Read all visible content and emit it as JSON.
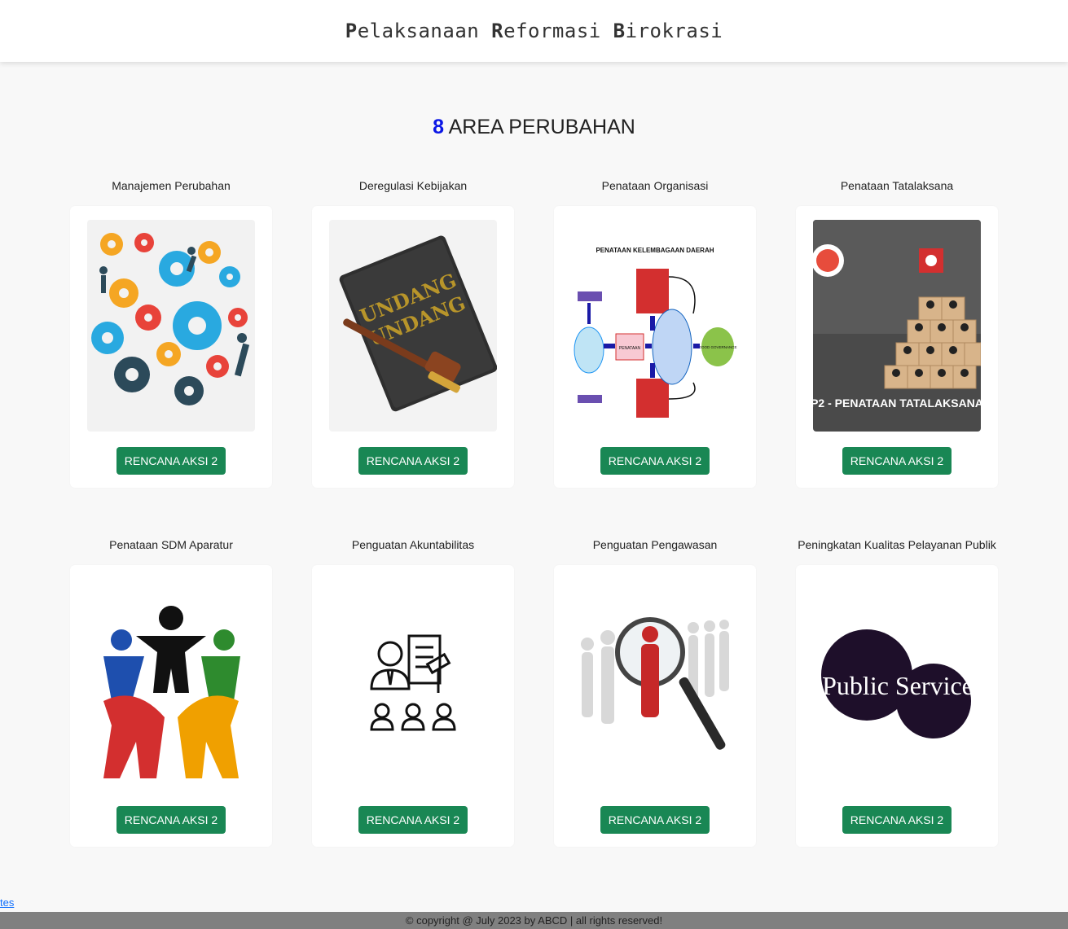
{
  "header": {
    "title_parts": [
      {
        "cap": "P",
        "rest": "elaksanaan "
      },
      {
        "cap": "R",
        "rest": "eformasi "
      },
      {
        "cap": "B",
        "rest": "irokrasi"
      }
    ]
  },
  "section": {
    "number": "8",
    "title": "AREA PERUBAHAN"
  },
  "areas": [
    {
      "label": "Manajemen Perubahan",
      "button": "RENCANA AKSI 2",
      "icon": "gears-people-icon"
    },
    {
      "label": "Deregulasi Kebijakan",
      "button": "RENCANA AKSI 2",
      "icon": "law-book-gavel-icon"
    },
    {
      "label": "Penataan Organisasi",
      "button": "RENCANA AKSI 2",
      "icon": "org-diagram-icon"
    },
    {
      "label": "Penataan Tatalaksana",
      "button": "RENCANA AKSI 2",
      "icon": "people-pyramid-icon"
    },
    {
      "label": "Penataan SDM Aparatur",
      "button": "RENCANA AKSI 2",
      "icon": "people-circle-icon"
    },
    {
      "label": "Penguatan Akuntabilitas",
      "button": "RENCANA AKSI 2",
      "icon": "accountability-icon"
    },
    {
      "label": "Penguatan Pengawasan",
      "button": "RENCANA AKSI 2",
      "icon": "magnifier-people-icon"
    },
    {
      "label": "Peningkatan Kualitas Pelayanan Publik",
      "button": "RENCANA AKSI 2",
      "icon": "public-service-icon"
    }
  ],
  "images": {
    "diagram_title": "PENATAAN KELEMBAGAAN DAERAH",
    "diagram_center": "PENATAAN",
    "diagram_goal": "GOOD GOVERNANCE",
    "pyramid_caption": "P2 - PENATAAN TATALAKSANA",
    "book_text_1": "UNDANG",
    "book_text_2": "UNDANG",
    "public_service_text": "Public Service"
  },
  "footer": {
    "link": "tes",
    "copyright": "© copyright @ July 2023 by ABCD | all rights reserved!"
  }
}
